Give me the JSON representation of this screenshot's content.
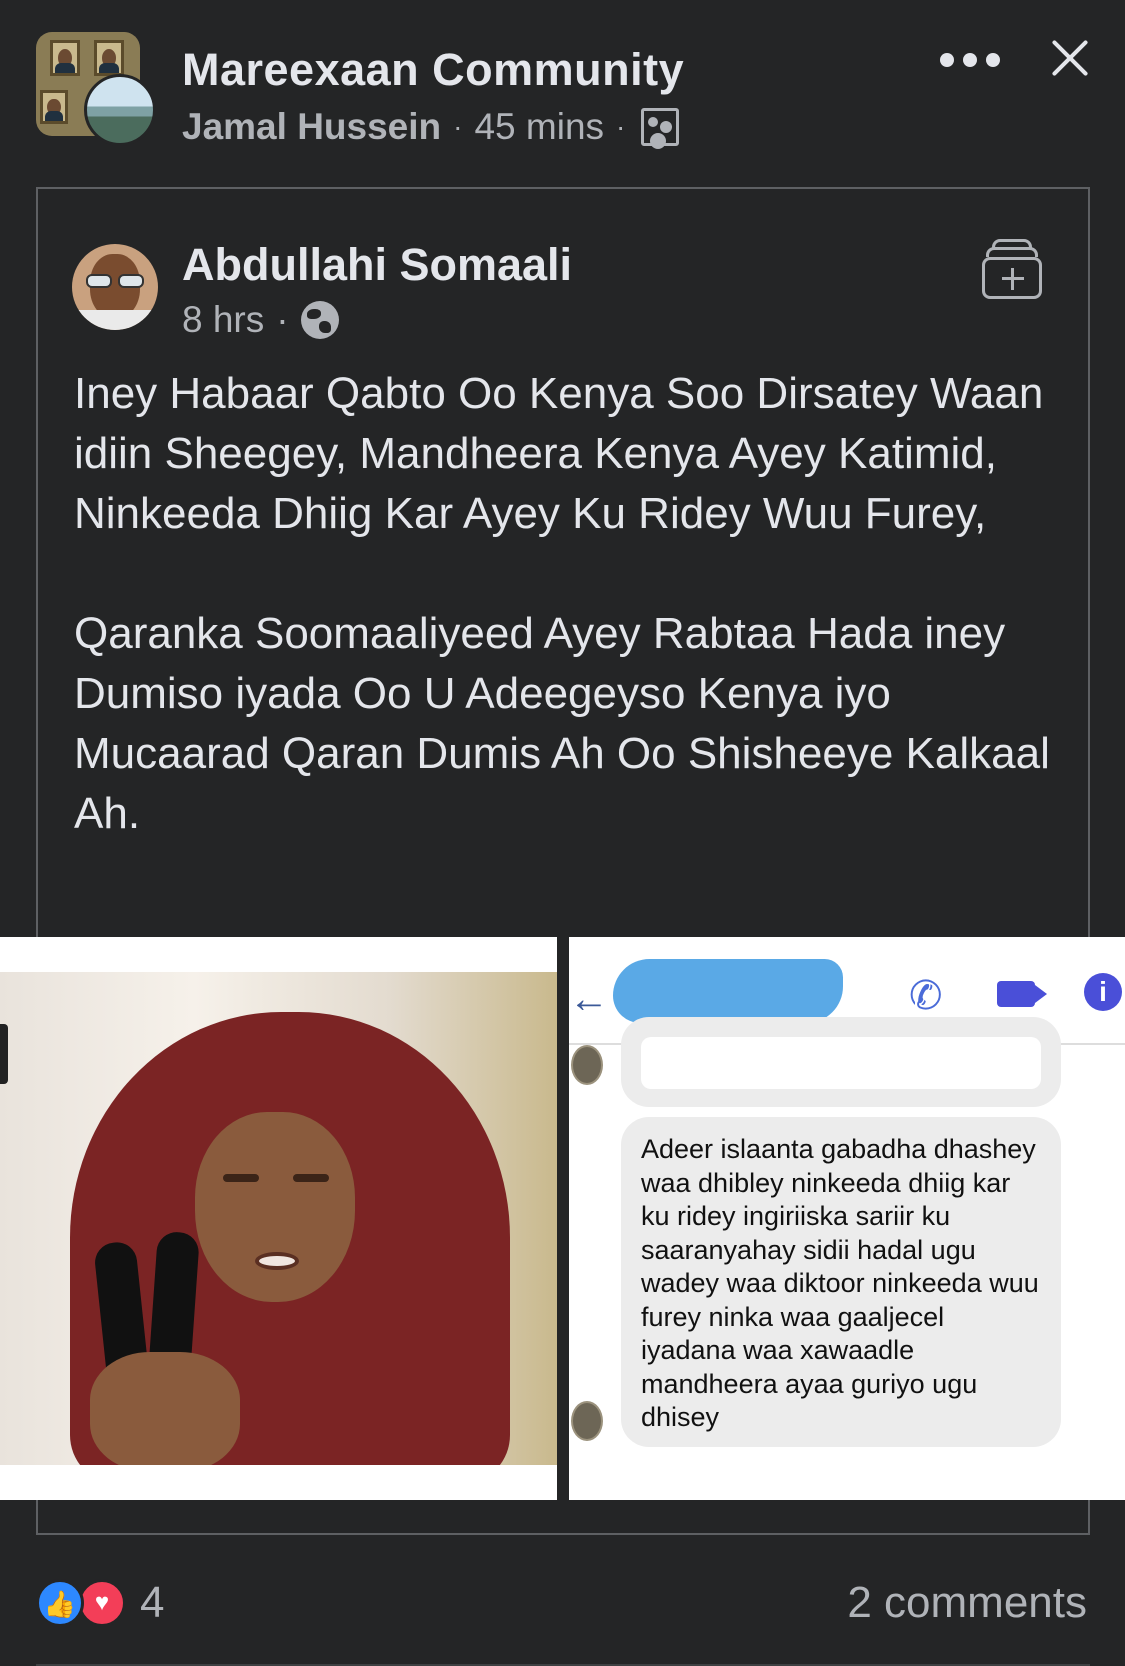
{
  "header": {
    "group_name": "Mareexaan Community",
    "author": "Jamal Hussein",
    "time": "45 mins",
    "separator": "·"
  },
  "shared_post": {
    "author": "Abdullahi Somaali",
    "time": "8 hrs",
    "separator": "·",
    "paragraphs": [
      "Iney Habaar Qabto Oo Kenya Soo Dirsatey Waan idiin Sheegey, Mandheera Kenya Ayey Katimid, Ninkeeda Dhiig Kar Ayey Ku Ridey Wuu Furey,",
      "Qaranka Soomaaliyeed Ayey Rabtaa Hada iney Dumiso iyada Oo U Adeegeyso Kenya iyo Mucaarad Qaran Dumis Ah Oo Shisheeye Kalkaal Ah."
    ]
  },
  "chat_screenshot": {
    "message_text": "Adeer islaanta gabadha dhashey waa dhibley ninkeeda dhiig kar ku ridey ingiriiska sariir ku saaranyahay sidii hadal ugu wadey waa diktoor ninkeeda wuu furey ninka waa gaaljecel iyadana waa xawaadle mandheera ayaa guriyo ugu dhisey"
  },
  "footer": {
    "reaction_count": "4",
    "comments_label": "2 comments"
  },
  "icons": {
    "more": "more-options-icon",
    "close": "close-icon",
    "group": "group-icon",
    "globe": "globe-icon",
    "save": "save-icon",
    "like": "like-reaction-icon",
    "love": "love-reaction-icon"
  },
  "colors": {
    "background": "#242526",
    "text_primary": "#e4e6eb",
    "text_secondary": "#b0b3b8",
    "like_blue": "#2d88ff",
    "love_red": "#f33e58"
  }
}
